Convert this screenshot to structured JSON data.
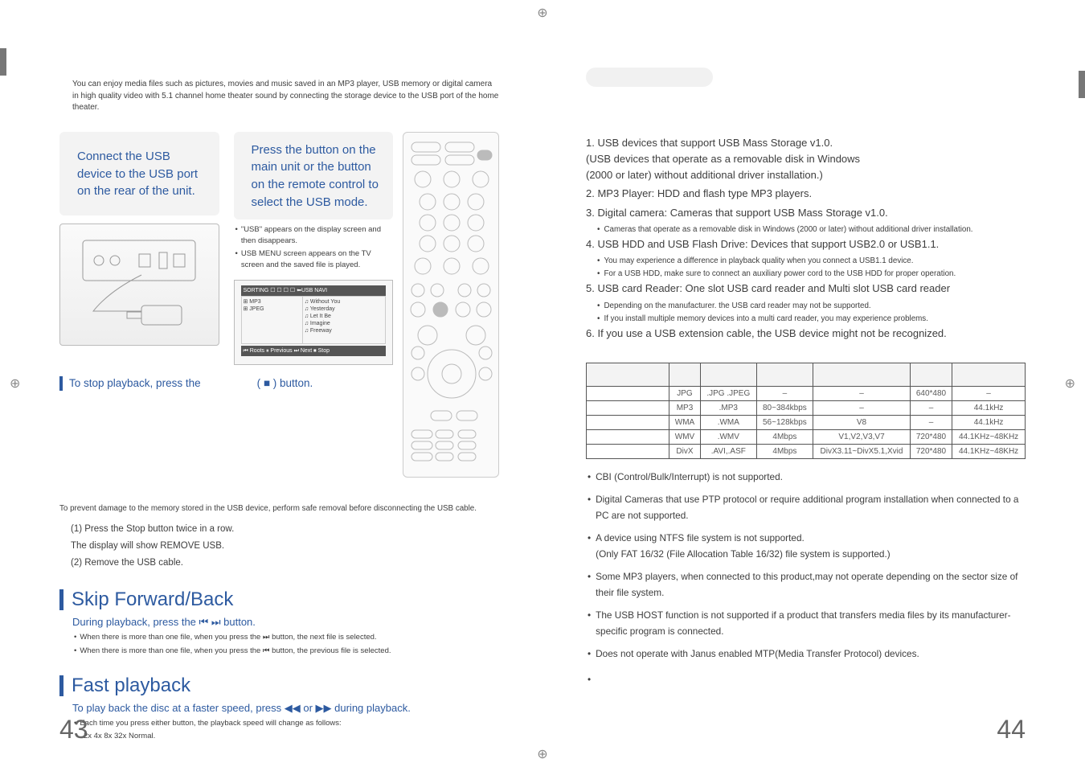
{
  "intro": "You can enjoy media files such as pictures, movies and music saved in an MP3 player, USB memory or digital camera in high quality video with 5.1 channel home theater sound by connecting the storage device to the USB port of the home theater.",
  "step1": "Connect the USB device to the USB port on the rear of the unit.",
  "step2_a": "Press the",
  "step2_b": "button on the main unit or the",
  "step2_c": "button on the remote control to select the USB mode.",
  "step2_bullets": [
    "\"USB\" appears on the display screen and then disappears.",
    "USB MENU screen appears on the TV screen and the saved file is played."
  ],
  "navscreen": {
    "title": "SORTING   ☐  ☐  ☐  ☐  ⬅USB NAVI",
    "rows": [
      "⊞ MP3",
      "⊞ JPEG"
    ],
    "songs": [
      "♫ Without You",
      "♫ Yesterday",
      "♫ Let It Be",
      "♫ Imagine",
      "♫ Freeway"
    ],
    "footer": "⏮ Roots   ⏸ Previous  ⏭ Next  ⏹ Stop"
  },
  "stop_line_a": "To stop playback, press the",
  "stop_button": "( ■ ) button.",
  "safe_remove": "To prevent damage to the memory stored in the USB device, perform safe removal before disconnecting the USB cable.",
  "safe_steps": [
    "(1)  Press the Stop button twice in a row.\n       The display will show REMOVE    USB.",
    "(2) Remove the USB cable."
  ],
  "section_skip": "Skip Forward/Back",
  "skip_blue": "During playback, press the ⏮ ⏭ button.",
  "skip_bullets": [
    "When there is more than one file, when you press the  ⏭  button, the next file is selected.",
    "When there is more than one file, when you press the  ⏮  button, the previous file is selected."
  ],
  "section_fast": "Fast playback",
  "fast_blue": "To play back the disc at a faster speed, press ◀◀ or ▶▶ during playback.",
  "fast_bullet": "Each time you press either button, the playback speed will change as follows:",
  "fast_rates": "2x    4x    8x    32x    Normal.",
  "page_left": "43",
  "page_right": "44",
  "compat": [
    {
      "main": "1. USB devices that support USB Mass Storage v1.0.\n    (USB devices that operate as a removable disk in Windows\n    (2000 or later) without additional driver installation.)"
    },
    {
      "main": "2. MP3 Player: HDD and flash type MP3 players."
    },
    {
      "main": "3. Digital camera: Cameras that support USB Mass Storage v1.0.",
      "subs": [
        "Cameras that operate as a removable disk in Windows (2000 or later) without additional driver installation."
      ]
    },
    {
      "main": "4. USB HDD and USB Flash Drive: Devices that support USB2.0 or USB1.1.",
      "subs": [
        "You may experience a difference in playback quality when you connect a USB1.1 device.",
        "For a USB HDD, make sure to connect an auxiliary power cord to the USB HDD for proper operation."
      ]
    },
    {
      "main": "5. USB card Reader: One slot USB card reader and Multi slot USB card reader",
      "subs": [
        "Depending on the manufacturer. the USB card reader may not be supported.",
        "If you install multiple memory devices into a multi card reader, you may experience problems."
      ]
    },
    {
      "main": "6. If you use a USB extension cable, the USB device might not be recognized."
    }
  ],
  "table_headers": [
    "",
    "",
    "",
    "",
    "",
    "",
    ""
  ],
  "table_rows": [
    {
      "c0": "",
      "c1": "JPG",
      "c2": ".JPG .JPEG",
      "c3": "–",
      "c4": "–",
      "c5": "640*480",
      "c6": "–"
    },
    {
      "c0": "",
      "c1": "MP3",
      "c2": ".MP3",
      "c3": "80~384kbps",
      "c4": "–",
      "c5": "–",
      "c6": "44.1kHz"
    },
    {
      "c0": "",
      "c1": "WMA",
      "c2": ".WMA",
      "c3": "56~128kbps",
      "c4": "V8",
      "c5": "–",
      "c6": "44.1kHz"
    },
    {
      "c0": "",
      "c1": "WMV",
      "c2": ".WMV",
      "c3": "4Mbps",
      "c4": "V1,V2,V3,V7",
      "c5": "720*480",
      "c6": "44.1KHz~48KHz"
    },
    {
      "c0": "",
      "c1": "DivX",
      "c2": ".AVI,.ASF",
      "c3": "4Mbps",
      "c4": "DivX3.11~DivX5.1,Xvid",
      "c5": "720*480",
      "c6": "44.1KHz~48KHz"
    }
  ],
  "notes": [
    "CBI (Control/Bulk/Interrupt) is not supported.",
    "Digital Cameras that use PTP protocol or require additional program installation when connected to a PC are not supported.",
    "A device using NTFS file system is not supported.\n(Only FAT 16/32 (File Allocation Table 16/32) file system is supported.)",
    "Some MP3 players, when connected to this product,may not operate depending on the sector size of their file system.",
    "The USB HOST function is not supported if a product that transfers media files by its manufacturer-specific program is connected.",
    "Does not operate with Janus enabled MTP(Media Transfer Protocol) devices."
  ]
}
